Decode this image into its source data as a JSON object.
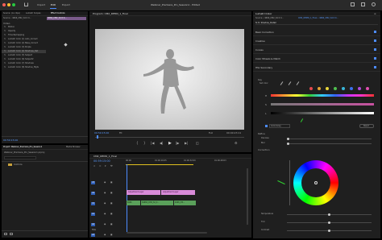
{
  "titlebar": {
    "title": "Webinar_Premiere_Pro_Session1 - Edited",
    "tabs": [
      "Import",
      "Edit",
      "Export"
    ],
    "active_tab": "Edit"
  },
  "effect_controls": {
    "tabs": [
      "Source: (no clips)",
      "Lumetri Scopes",
      "Effect Controls",
      "Audio"
    ],
    "source_path": "Source • 4666_CM2_S4 6 0...",
    "clip_name": "4666_CM2_S4 6 0...",
    "section": "Video",
    "items": [
      "Motion",
      "Opacity",
      "Time Remapping",
      "Lumetri Color (1) Auto_Correct",
      "Lumetri Color (2) Base_Correct",
      "Lumetri Color (3) Purple",
      "Lumetri Color (4) Shadows_Det",
      "Lumetri Color (5) Subject",
      "Lumetri Color (6) Subject2",
      "Lumetri Color (7) Shadows",
      "Lumetri Color (8) Shadow_Hlgts"
    ],
    "selected_index": 6,
    "timecode": "00:59:15:00"
  },
  "program": {
    "title": "Program: CM2_DEMO_1_Final",
    "timecode_left": "00:59:15:00",
    "fit_label": "Fit",
    "zoom": "Full",
    "timecode_right": "00:00:23:11"
  },
  "project": {
    "tabs": [
      "Project: Webinar_Premiere_Pro_Session1",
      "Media Browser"
    ],
    "name": "Webinar_Premiere_Pro_Session1.prproj",
    "folder": "Cstmrs"
  },
  "timeline": {
    "tab": "CM2_DEMO_1_Final",
    "timecode": "00:59:15:00",
    "ruler": [
      "00:00",
      "01:00:16:05",
      "01:00:32:00",
      "01:00:48:03"
    ],
    "tracks": [
      "V3",
      "V2",
      "V1",
      "A1",
      "A2",
      "A3"
    ],
    "clip_v2a": "Adjustment Layer",
    "clip_v2b": "Adjustment Layer",
    "clip_v1a": "4666",
    "clip_v1b": "S4666_CM2_S4_0...",
    "clip_v1c": "4666_CM...",
    "mix": "Mix"
  },
  "lumetri": {
    "title": "Lumetri Color",
    "source": "Source • 4666_CM2_S4 6 0...",
    "clip": "CM2_DEMO_1_Final • 4666_CM2_S4 6 0...",
    "effect_select": "fx   8. Shadow_Detail",
    "sections": [
      "Basic Correction",
      "Creative",
      "Curves",
      "Color Wheels & Match",
      "HSL Secondary"
    ],
    "key_label": "Key",
    "set_color": "Set color",
    "hsl_labels": [
      "H",
      "S",
      "L"
    ],
    "color_gray": "Color/Gray",
    "reset": "Reset",
    "refine": "Refine",
    "denoise": "Denoise",
    "blur": "Blur",
    "correction": "Correction",
    "sliders": [
      "Temperature",
      "Tint",
      "Contrast"
    ],
    "swatches": [
      "#e5484d",
      "#e5a334",
      "#e8d63a",
      "#4fbf4f",
      "#38b6d9",
      "#3a6ff0",
      "#b04be0",
      "#e04fb0"
    ],
    "accent": "#4d8cff"
  }
}
